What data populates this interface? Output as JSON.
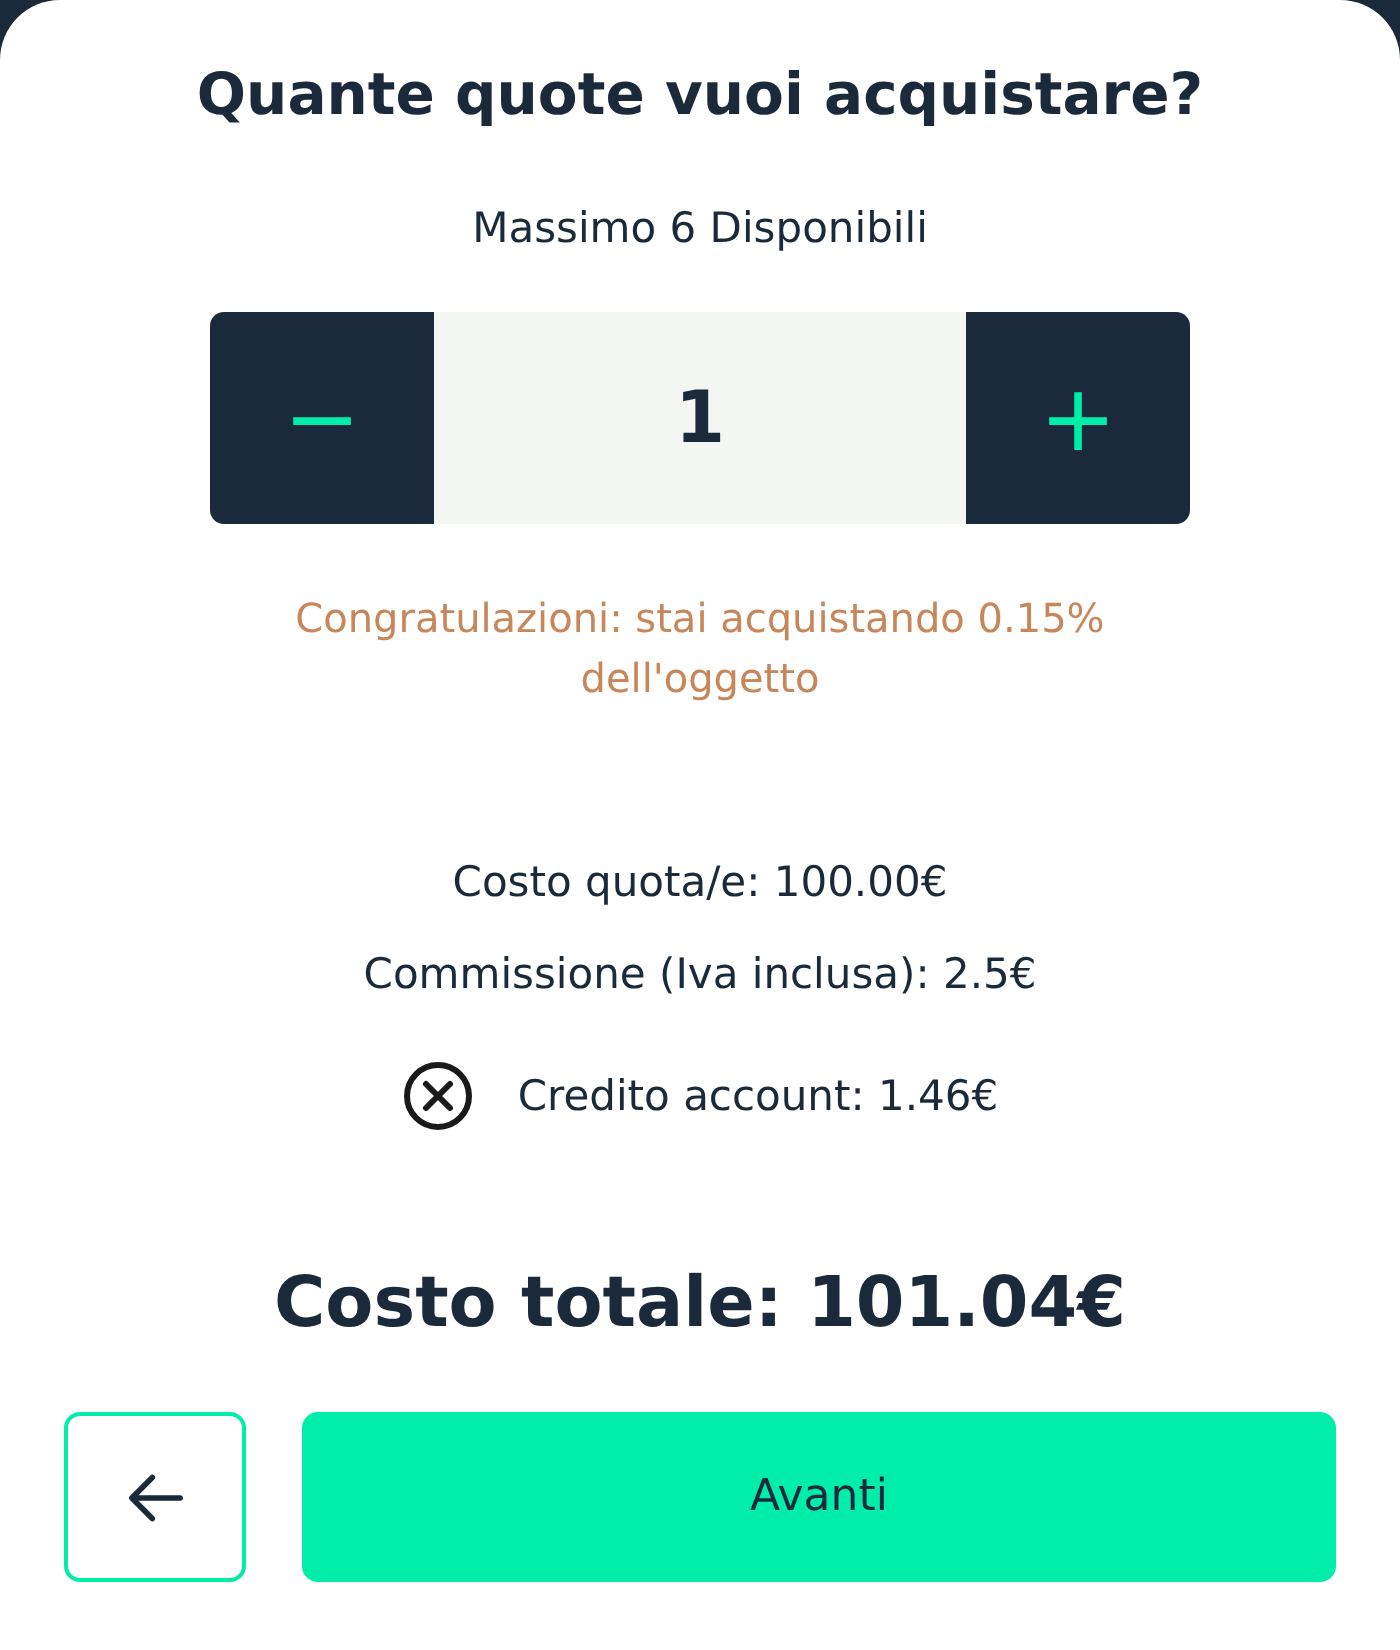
{
  "title": "Quante quote vuoi acquistare?",
  "availability": "Massimo 6 Disponibili",
  "stepper": {
    "decrement": "−",
    "value": "1",
    "increment": "+"
  },
  "message": "Congratulazioni: stai acquistando 0.15% dell'oggetto",
  "costs": [
    {
      "kind": "plain",
      "text": "Costo quota/e: 100.00€"
    },
    {
      "kind": "plain",
      "text": "Commissione (Iva inclusa): 2.5€"
    },
    {
      "kind": "credit",
      "text": "Credito account: 1.46€"
    }
  ],
  "total": "Costo totale: 101.04€",
  "buttons": {
    "next": "Avanti"
  }
}
